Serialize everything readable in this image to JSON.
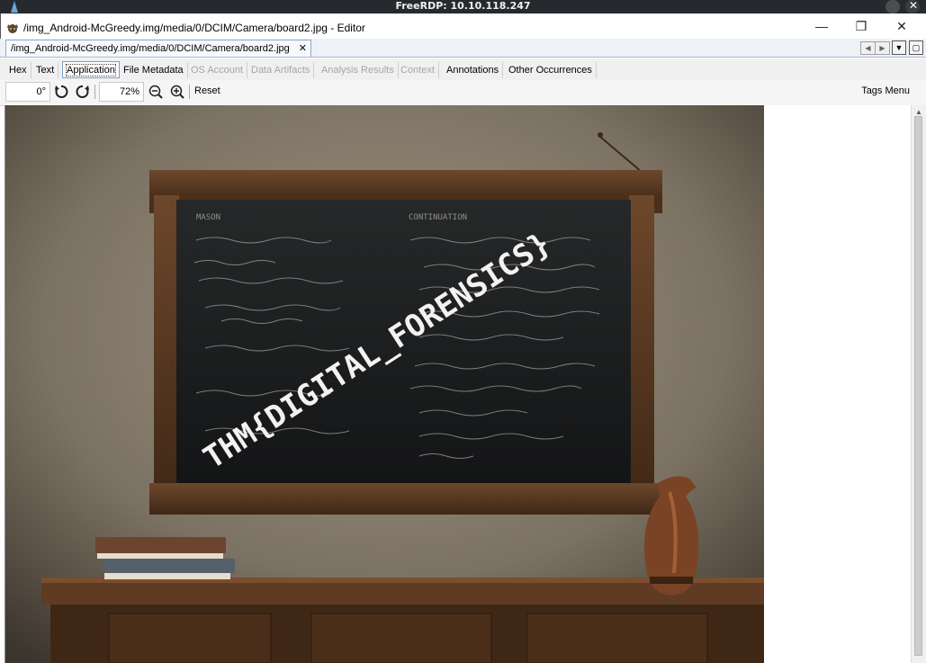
{
  "rdp": {
    "title": "FreeRDP: 10.10.118.247",
    "close_glyph": "✕"
  },
  "window": {
    "title": "/img_Android-McGreedy.img/media/0/DCIM/Camera/board2.jpg - Editor",
    "minimize": "—",
    "restore": "❐",
    "close": "✕"
  },
  "doc_tab": {
    "label": "/img_Android-McGreedy.img/media/0/DCIM/Camera/board2.jpg",
    "close": "✕",
    "prev": "◀",
    "next": "▶",
    "dropdown": "▼",
    "maximize": "▢"
  },
  "viewer_tabs": [
    {
      "label": "Hex",
      "state": "normal"
    },
    {
      "label": "Text",
      "state": "normal"
    },
    {
      "label": "Application",
      "state": "active"
    },
    {
      "label": "File Metadata",
      "state": "normal"
    },
    {
      "label": "OS Account",
      "state": "disabled"
    },
    {
      "label": "Data Artifacts",
      "state": "disabled"
    },
    {
      "label": "Analysis Results",
      "state": "disabled"
    },
    {
      "label": "Context",
      "state": "disabled"
    },
    {
      "label": "Annotations",
      "state": "normal"
    },
    {
      "label": "Other Occurrences",
      "state": "normal"
    }
  ],
  "toolbar": {
    "rotation": "0°",
    "zoom": "72%",
    "reset": "Reset",
    "tags_menu": "Tags Menu"
  },
  "image": {
    "watermark": "THM{DIGITAL_FORENSICS}",
    "board_left_heading": "MASON",
    "board_right_heading": "CONTINUATION",
    "colors": {
      "wall": "#8a7e6e",
      "frame": "#5a3a22",
      "board": "#1c1e1f",
      "chalk": "#d8d8d4"
    }
  }
}
